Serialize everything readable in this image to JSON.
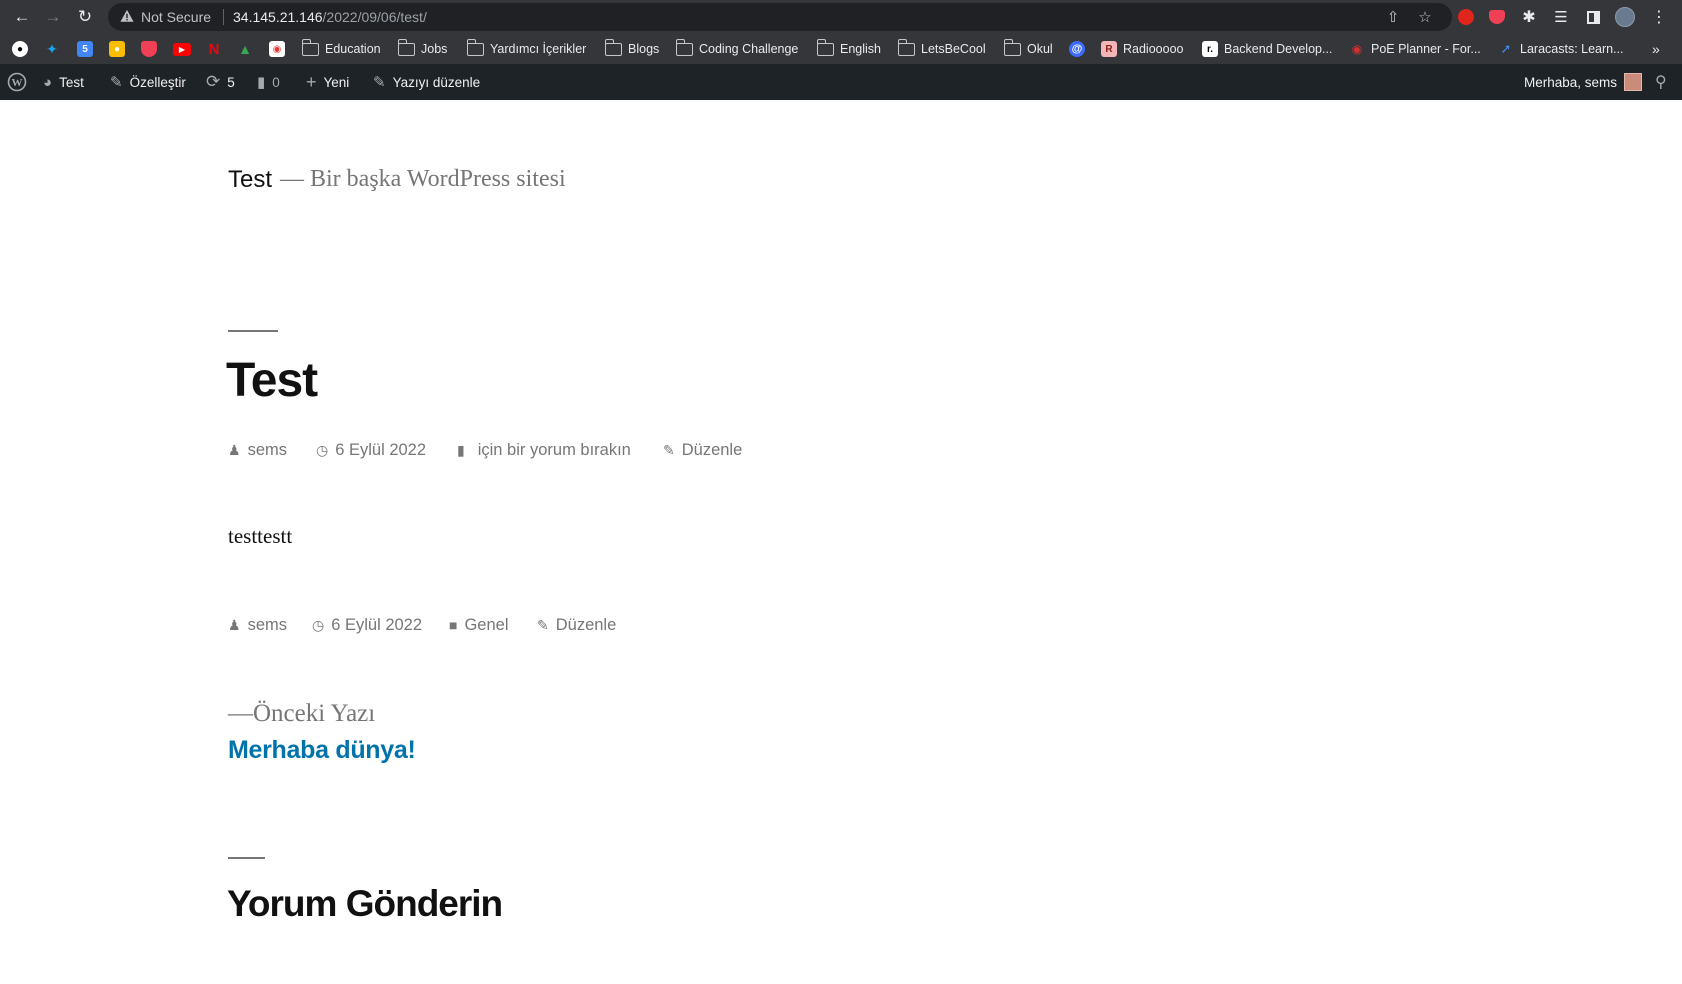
{
  "browser": {
    "security_label": "Not Secure",
    "url_host": "34.145.21.146",
    "url_path": "/2022/09/06/test/",
    "bookmarks": {
      "education": "Education",
      "jobs": "Jobs",
      "yardimci": "Yardımcı İçerikler",
      "blogs": "Blogs",
      "coding": "Coding Challenge",
      "english": "English",
      "letsbecool": "LetsBeCool",
      "okul": "Okul",
      "radio": "Radiooooo",
      "backend": "Backend Develop...",
      "poe": "PoE Planner - For...",
      "laracasts": "Laracasts: Learn...",
      "overflow": "»"
    }
  },
  "adminbar": {
    "site_name": "Test",
    "customize": "Özelleştir",
    "updates_count": "5",
    "comments_count": "0",
    "new_label": "Yeni",
    "edit_post": "Yazıyı düzenle",
    "greeting": "Merhaba, sems"
  },
  "site": {
    "title": "Test",
    "description": "— Bir başka WordPress sitesi"
  },
  "post": {
    "title": "Test",
    "author": "sems",
    "date": "6 Eylül 2022",
    "comment_link": "için bir yorum bırakın",
    "edit_label": "Düzenle",
    "body": "testtestt",
    "category": "Genel"
  },
  "navigation": {
    "prev_label": "—Önceki Yazı",
    "prev_title": "Merhaba dünya!"
  },
  "comments": {
    "title": "Yorum Gönderin"
  },
  "colors": {
    "chrome_toolbar": "#35363a",
    "omnibox": "#202124",
    "wp_adminbar": "#1d2327",
    "link_blue": "#0073aa",
    "meta_gray": "#767676"
  }
}
